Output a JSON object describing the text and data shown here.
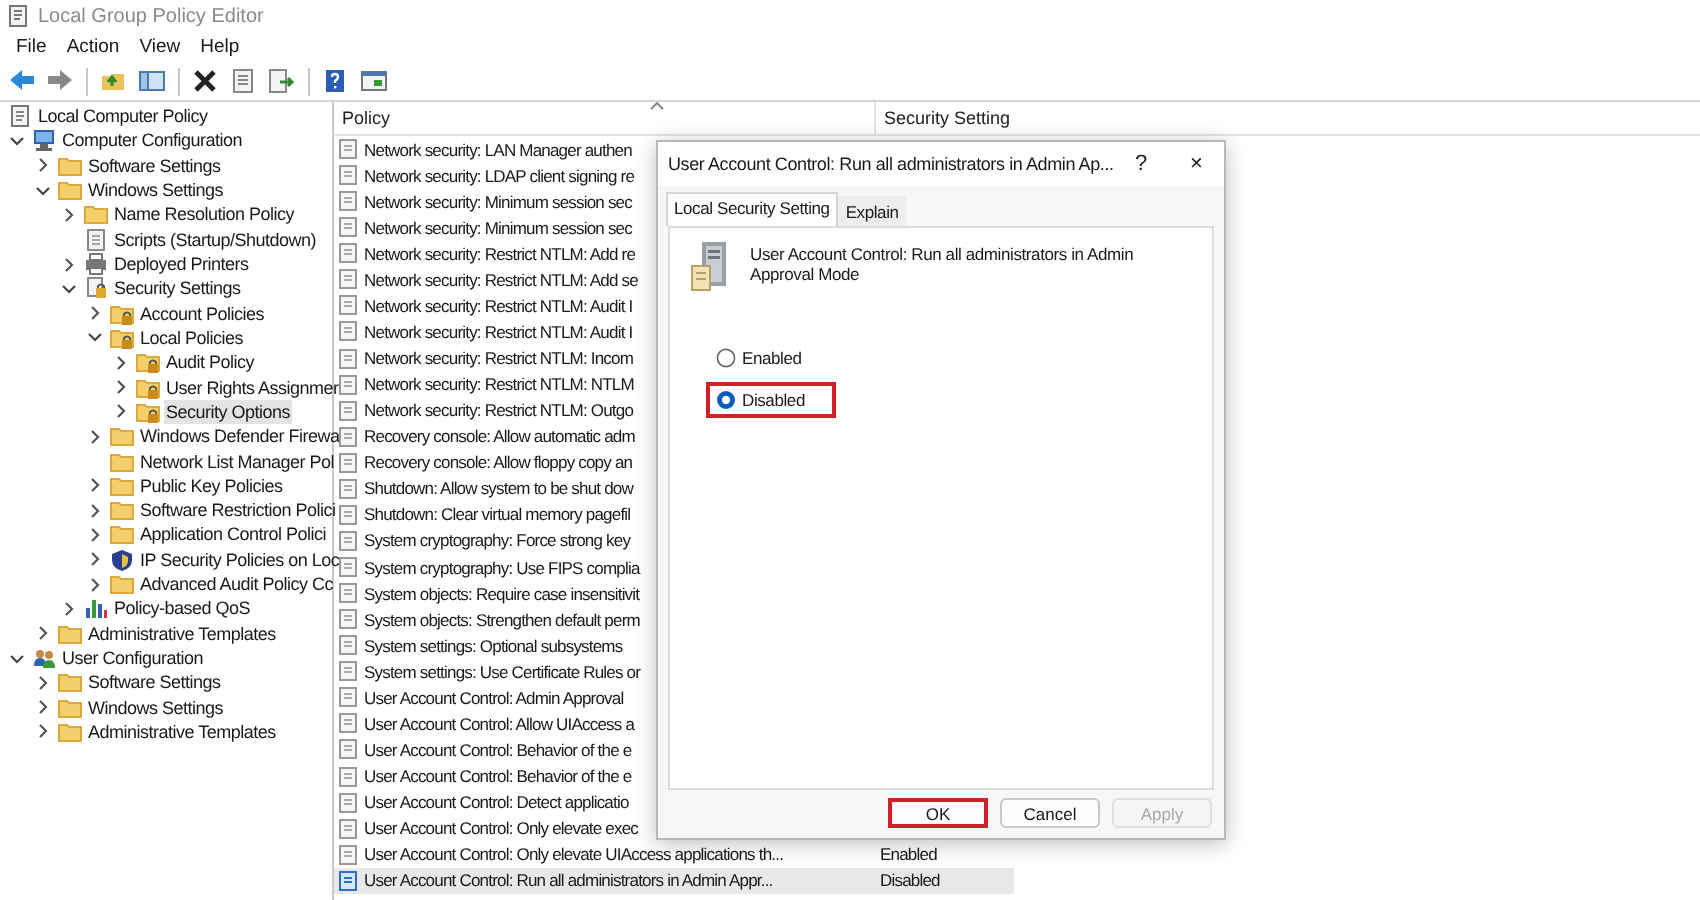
{
  "window": {
    "title": "Local Group Policy Editor"
  },
  "menu": [
    "File",
    "Action",
    "View",
    "Help"
  ],
  "toolbar": [
    {
      "kind": "back"
    },
    {
      "kind": "forward"
    },
    {
      "kind": "sep"
    },
    {
      "kind": "up"
    },
    {
      "kind": "tree"
    },
    {
      "kind": "sep"
    },
    {
      "kind": "delete"
    },
    {
      "kind": "properties"
    },
    {
      "kind": "export"
    },
    {
      "kind": "sep"
    },
    {
      "kind": "help"
    },
    {
      "kind": "console"
    }
  ],
  "tree": [
    {
      "label": "Local Computer Policy",
      "kind": "policy",
      "selected": false,
      "children": [
        {
          "label": "Computer Configuration",
          "kind": "computer",
          "expanded": true,
          "selected": false,
          "children": [
            {
              "label": "Software Settings",
              "kind": "folder",
              "expanded": false,
              "selected": false
            },
            {
              "label": "Windows Settings",
              "kind": "folder",
              "expanded": true,
              "selected": false,
              "children": [
                {
                  "label": "Name Resolution Policy",
                  "kind": "folder",
                  "expanded": false,
                  "selected": false
                },
                {
                  "label": "Scripts (Startup/Shutdown)",
                  "kind": "scripts",
                  "selected": false
                },
                {
                  "label": "Deployed Printers",
                  "kind": "printer",
                  "expanded": false,
                  "selected": false
                },
                {
                  "label": "Security Settings",
                  "kind": "security",
                  "expanded": true,
                  "selected": false,
                  "children": [
                    {
                      "label": "Account Policies",
                      "kind": "lock-folder",
                      "expanded": false,
                      "selected": false
                    },
                    {
                      "label": "Local Policies",
                      "kind": "lock-folder",
                      "expanded": true,
                      "selected": false,
                      "children": [
                        {
                          "label": "Audit Policy",
                          "kind": "lock-folder",
                          "expanded": false,
                          "selected": false
                        },
                        {
                          "label": "User Rights Assignmer",
                          "kind": "lock-folder",
                          "expanded": false,
                          "selected": false
                        },
                        {
                          "label": "Security Options",
                          "kind": "lock-folder",
                          "expanded": false,
                          "selected": true
                        }
                      ]
                    },
                    {
                      "label": "Windows Defender Firewa",
                      "kind": "folder",
                      "expanded": false,
                      "selected": false
                    },
                    {
                      "label": "Network List Manager Pol",
                      "kind": "folder",
                      "selected": false
                    },
                    {
                      "label": "Public Key Policies",
                      "kind": "folder",
                      "expanded": false,
                      "selected": false
                    },
                    {
                      "label": "Software Restriction Polici",
                      "kind": "folder",
                      "expanded": false,
                      "selected": false
                    },
                    {
                      "label": "Application Control Polici",
                      "kind": "folder",
                      "expanded": false,
                      "selected": false
                    },
                    {
                      "label": "IP Security Policies on Loc",
                      "kind": "ipsec",
                      "expanded": false,
                      "selected": false
                    },
                    {
                      "label": "Advanced Audit Policy Cc",
                      "kind": "folder",
                      "expanded": false,
                      "selected": false
                    }
                  ]
                },
                {
                  "label": "Policy-based QoS",
                  "kind": "qos",
                  "expanded": false,
                  "selected": false
                }
              ]
            },
            {
              "label": "Administrative Templates",
              "kind": "folder",
              "expanded": false,
              "selected": false
            }
          ]
        },
        {
          "label": "User Configuration",
          "kind": "user",
          "expanded": true,
          "selected": false,
          "children": [
            {
              "label": "Software Settings",
              "kind": "folder",
              "expanded": false,
              "selected": false
            },
            {
              "label": "Windows Settings",
              "kind": "folder",
              "expanded": false,
              "selected": false
            },
            {
              "label": "Administrative Templates",
              "kind": "folder",
              "expanded": false,
              "selected": false
            }
          ]
        }
      ]
    }
  ],
  "list": {
    "columns": [
      "Policy",
      "Security Setting"
    ],
    "rows": [
      {
        "policy": "Network security: LAN Manager authen",
        "selected": false
      },
      {
        "policy": "Network security: LDAP client signing re",
        "selected": false
      },
      {
        "policy": "Network security: Minimum session sec",
        "selected": false
      },
      {
        "policy": "Network security: Minimum session sec",
        "selected": false
      },
      {
        "policy": "Network security: Restrict NTLM: Add re",
        "selected": false
      },
      {
        "policy": "Network security: Restrict NTLM: Add se",
        "selected": false
      },
      {
        "policy": "Network security: Restrict NTLM: Audit I",
        "selected": false
      },
      {
        "policy": "Network security: Restrict NTLM: Audit I",
        "selected": false
      },
      {
        "policy": "Network security: Restrict NTLM: Incom",
        "selected": false
      },
      {
        "policy": "Network security: Restrict NTLM: NTLM",
        "selected": false
      },
      {
        "policy": "Network security: Restrict NTLM: Outgo",
        "selected": false
      },
      {
        "policy": "Recovery console: Allow automatic adm",
        "selected": false
      },
      {
        "policy": "Recovery console: Allow floppy copy an",
        "selected": false
      },
      {
        "policy": "Shutdown: Allow system to be shut dow",
        "selected": false
      },
      {
        "policy": "Shutdown: Clear virtual memory pagefil",
        "selected": false
      },
      {
        "policy": "System cryptography: Force strong key",
        "selected": false
      },
      {
        "policy": "System cryptography: Use FIPS complia",
        "selected": false
      },
      {
        "policy": "System objects: Require case insensitivit",
        "selected": false
      },
      {
        "policy": "System objects: Strengthen default perm",
        "selected": false
      },
      {
        "policy": "System settings: Optional subsystems",
        "selected": false
      },
      {
        "policy": "System settings: Use Certificate Rules or",
        "selected": false
      },
      {
        "policy": "User Account Control: Admin Approval",
        "selected": false
      },
      {
        "policy": "User Account Control: Allow UIAccess a",
        "selected": false
      },
      {
        "policy": "User Account Control: Behavior of the e",
        "selected": false
      },
      {
        "policy": "User Account Control: Behavior of the e",
        "selected": false
      },
      {
        "policy": "User Account Control: Detect applicatio",
        "selected": false
      },
      {
        "policy": "User Account Control: Only elevate exec",
        "selected": false
      },
      {
        "policy": "User Account Control: Only elevate UIAccess applications th...",
        "setting": "Enabled",
        "selected": false
      },
      {
        "policy": "User Account Control: Run all administrators in Admin Appr...",
        "setting": "Disabled",
        "selected": true
      }
    ]
  },
  "dialog": {
    "title": "User Account Control: Run all administrators in Admin Ap...",
    "help": "?",
    "close": "×",
    "tabs": [
      {
        "label": "Local Security Setting",
        "selected": true
      },
      {
        "label": "Explain",
        "selected": false
      }
    ],
    "description": "User Account Control: Run all administrators in Admin Approval Mode",
    "options": [
      {
        "label": "Enabled",
        "selected": false,
        "highlighted": false
      },
      {
        "label": "Disabled",
        "selected": true,
        "highlighted": true
      }
    ],
    "buttons": [
      {
        "label": "OK",
        "disabled": false,
        "highlighted": true
      },
      {
        "label": "Cancel",
        "disabled": false,
        "highlighted": false
      },
      {
        "label": "Apply",
        "disabled": true,
        "highlighted": false
      }
    ]
  }
}
